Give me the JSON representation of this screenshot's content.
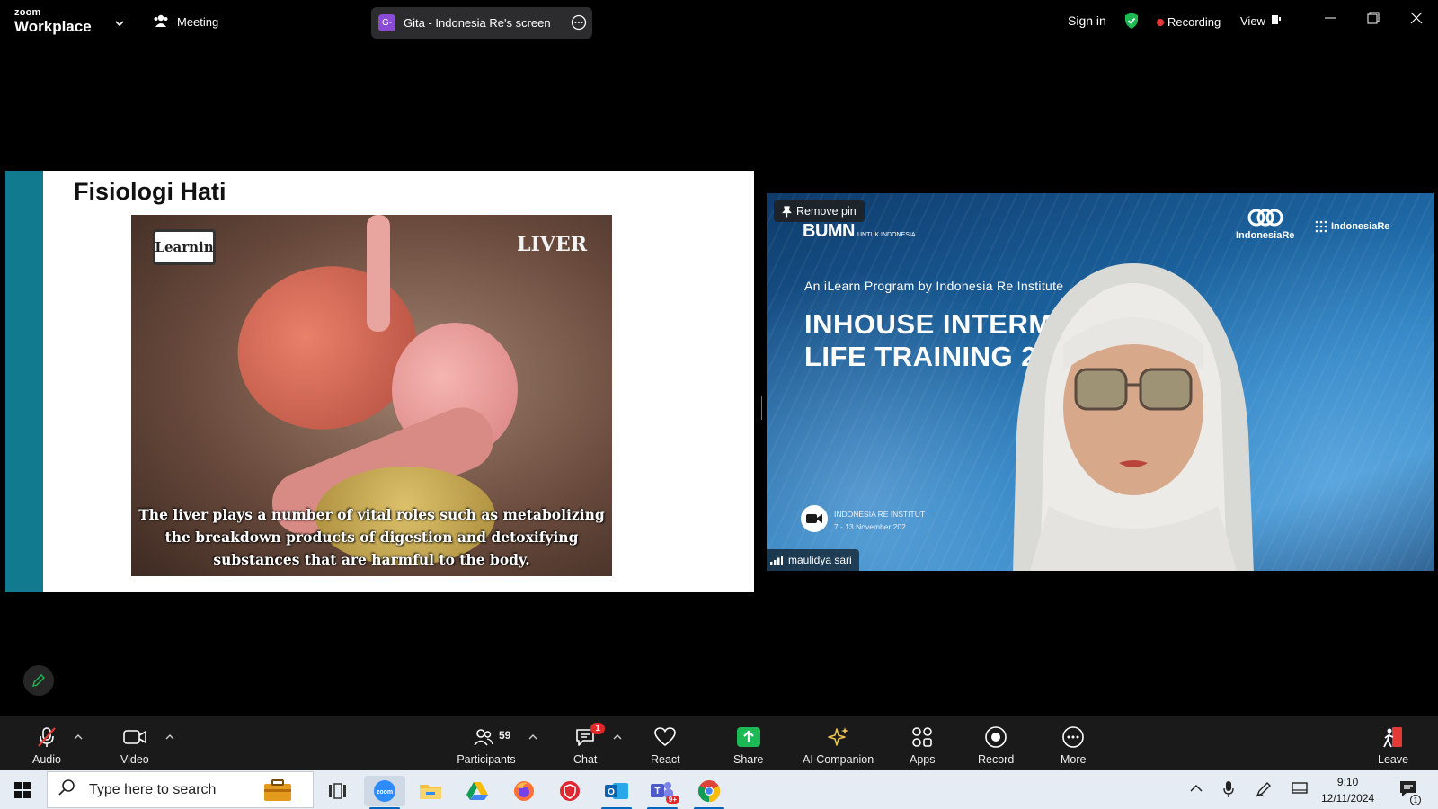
{
  "app": {
    "logo_top": "zoom",
    "logo_bottom": "Workplace",
    "meeting_label": "Meeting",
    "share_pill_initial": "G-",
    "share_pill_label": "Gita - Indonesia Re's screen",
    "sign_in": "Sign in",
    "recording_label": "Recording",
    "view_label": "View"
  },
  "slide": {
    "title": "Fisiologi Hati",
    "video_logo": "Learnin",
    "video_label": "LIVER",
    "caption": "The liver plays a number of vital roles such as metabolizing the breakdown products of digestion and detoxifying substances that are harmful to the body."
  },
  "participant": {
    "remove_pin": "Remove pin",
    "bg_org": "BUMN",
    "bg_org_small": "UNTUK INDONESIA",
    "bg_brand": "IndonesiaRe",
    "bg_institute": "IndonesiaRe",
    "bg_program": "An iLearn Program by Indonesia Re Institute",
    "bg_headline_1": "INHOUSE INTERM",
    "bg_headline_2": "LIFE TRAINING 2",
    "bg_event_1": "INDONESIA RE INSTITUT",
    "bg_event_2": "7 - 13 November 202",
    "name": "maulidya sari"
  },
  "controls": {
    "audio": "Audio",
    "video": "Video",
    "participants": "Participants",
    "participants_count": "59",
    "chat": "Chat",
    "chat_badge": "1",
    "react": "React",
    "share": "Share",
    "ai_companion": "AI Companion",
    "apps": "Apps",
    "record": "Record",
    "more": "More",
    "leave": "Leave"
  },
  "taskbar": {
    "search_placeholder": "Type here to search",
    "teams_badge": "9+",
    "time": "9:10",
    "date": "12/11/2024",
    "notifications": "1"
  },
  "colors": {
    "accent_green": "#1db954",
    "recording_red": "#e53935",
    "slide_band": "#127a8f"
  }
}
